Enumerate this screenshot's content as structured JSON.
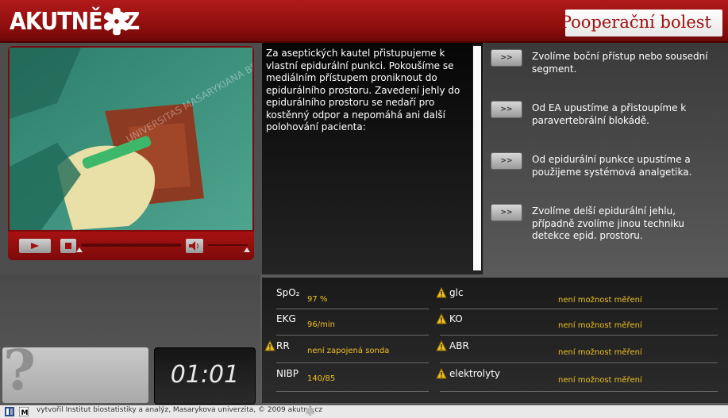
{
  "header": {
    "logo_text": "AKUTNĚ.CZ",
    "title": "Pooperační bolest"
  },
  "scenario": {
    "text": "Za aseptických kautel přistupujeme k vlastní epidurální punkci. Pokoušíme se mediálním přístupem proniknout do epidurálního prostoru. Zavedení jehly do epidurálního prostoru se nedaří pro kostěnný odpor a nepomáhá ani další polohování pacienta:"
  },
  "video_watermark": "UNIVERSITAS MASARYKIANA BRUNENSIS · FACULTAS MEDICA",
  "options": [
    {
      "button": ">>",
      "text": "Zvolíme boční přístup nebo sousední segment."
    },
    {
      "button": ">>",
      "text": "Od EA upustíme a přistoupíme k paravertebrální blokádě."
    },
    {
      "button": ">>",
      "text": "Od epidurální punkce upustíme a použijeme systémová analgetika."
    },
    {
      "button": ">>",
      "text": "Zvolíme delší epidurální jehlu, případně zvolíme jinou techniku detekce epid. prostoru."
    }
  ],
  "timer": "01:01",
  "question_mark": "?",
  "vitals": {
    "left": [
      {
        "label": "SpO₂",
        "value": "97 %",
        "warning": false
      },
      {
        "label": "EKG",
        "value": "96/min",
        "warning": false
      },
      {
        "label": "RR",
        "value": "není zapojená sonda",
        "warning": true
      },
      {
        "label": "NIBP",
        "value": "140/85",
        "warning": false
      }
    ],
    "right": [
      {
        "label": "glc",
        "value": "není možnost měření",
        "warning": true
      },
      {
        "label": "KO",
        "value": "není možnost měření",
        "warning": true
      },
      {
        "label": "ABR",
        "value": "není možnost měření",
        "warning": true
      },
      {
        "label": "elektrolyty",
        "value": "není možnost měření",
        "warning": true
      }
    ]
  },
  "footer": {
    "text": "vytvořil Institut biostatistiky a analýz, Masarykova univerzita, © 2009 akutně.cz"
  },
  "colors": {
    "brand_red": "#9e1111",
    "value_yellow": "#f0c020",
    "warning_yellow": "#f0c020"
  }
}
